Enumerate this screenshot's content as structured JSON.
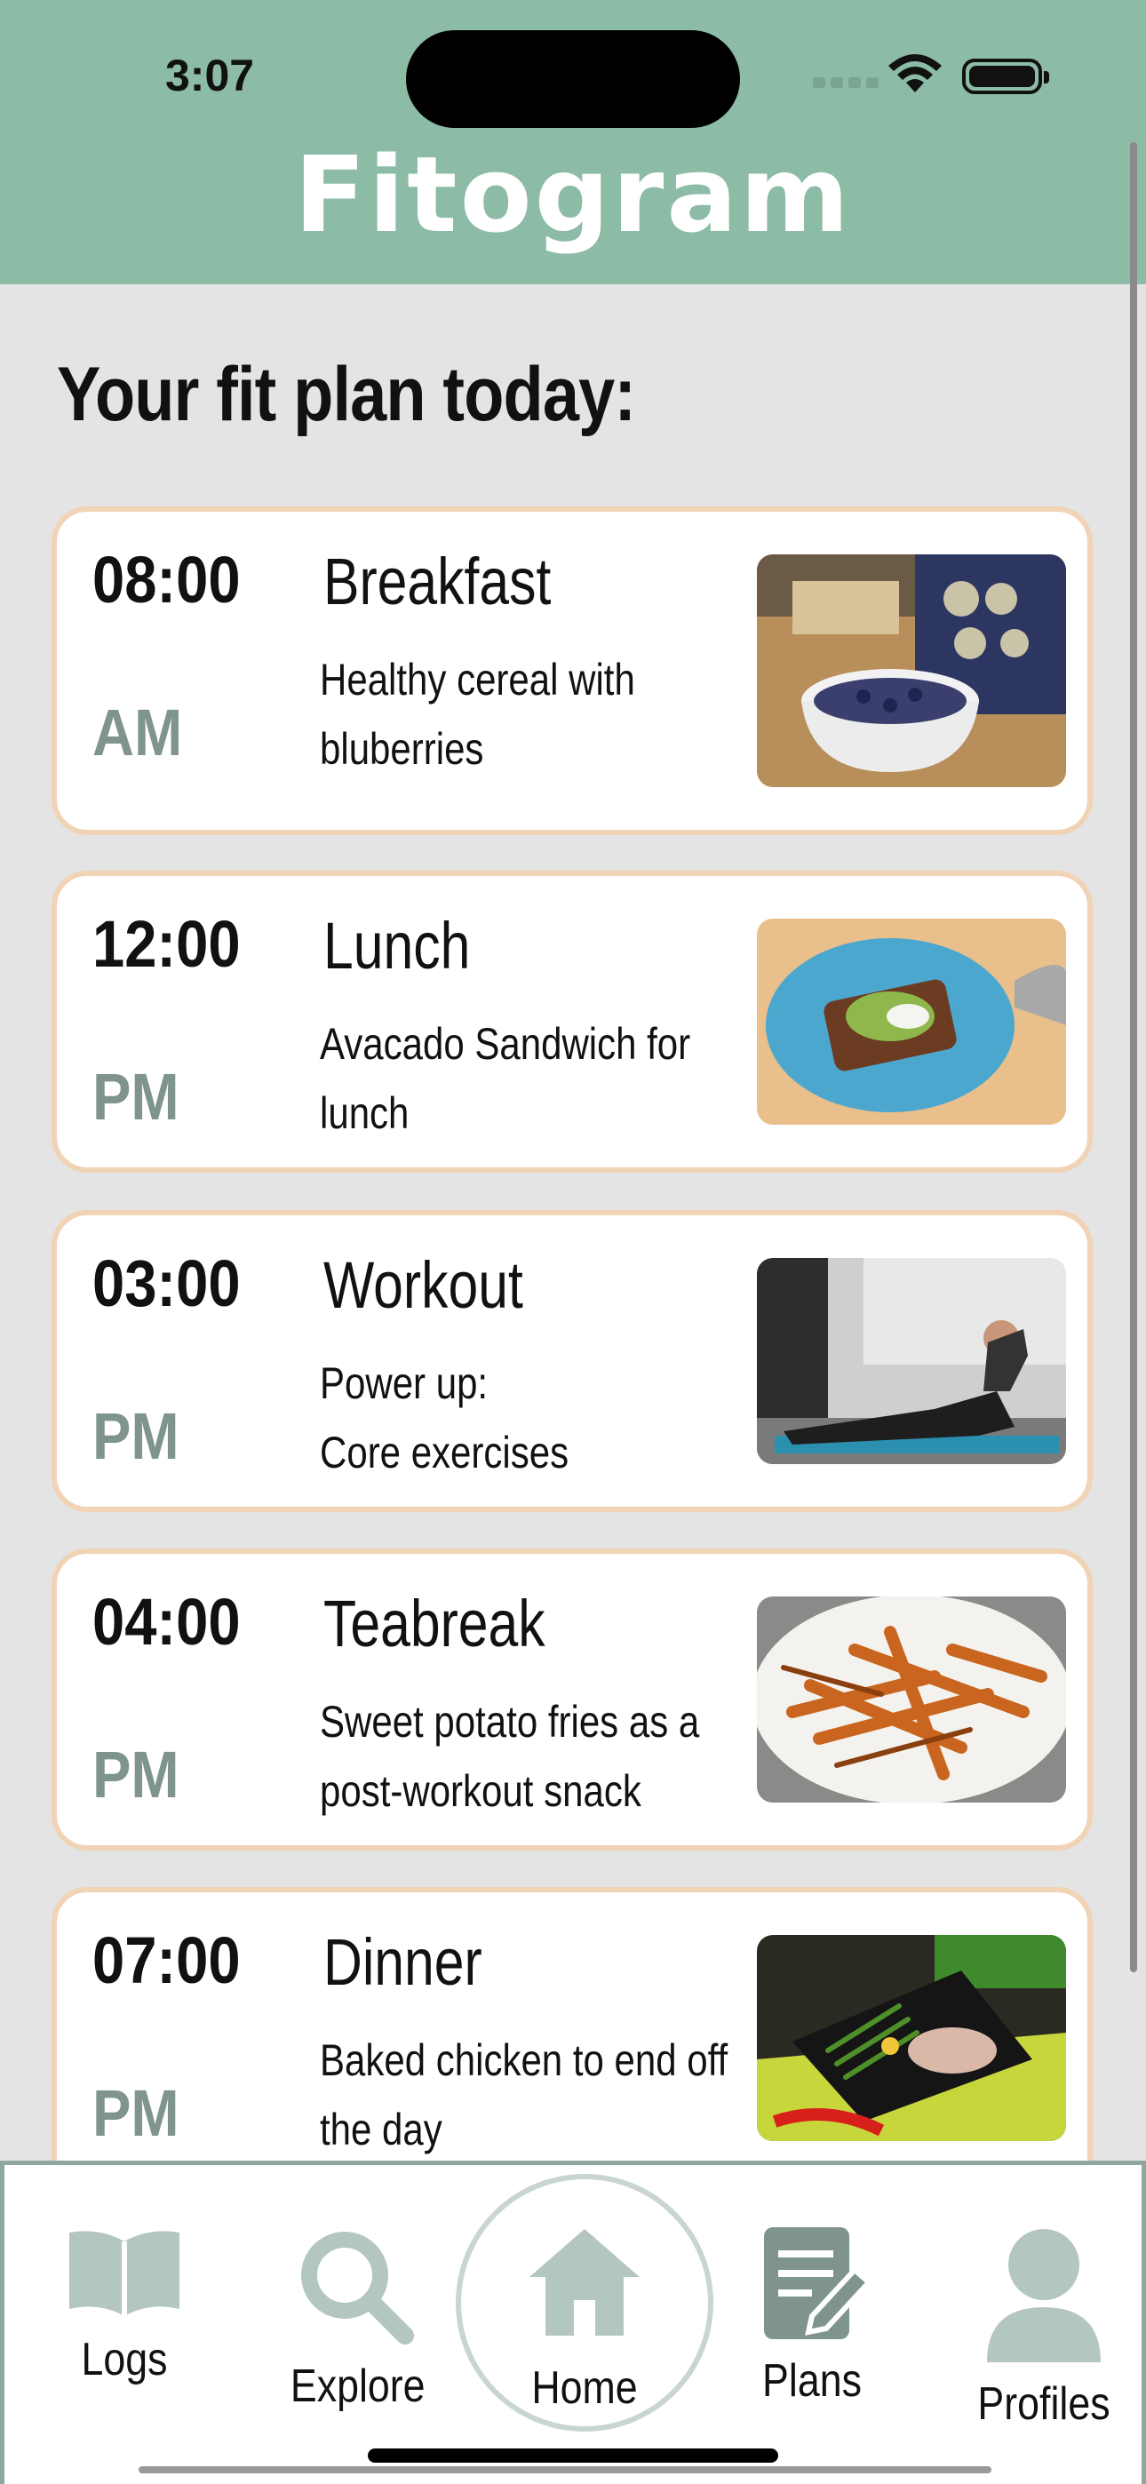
{
  "status_bar": {
    "time": "3:07"
  },
  "app": {
    "title": "Fitogram"
  },
  "main": {
    "heading": "Your fit plan today:",
    "items": [
      {
        "time": "08:00",
        "ampm": "AM",
        "title": "Breakfast",
        "description": "Healthy cereal with\nbluberries",
        "image": "cereal-bowl-photo"
      },
      {
        "time": "12:00",
        "ampm": "PM",
        "title": "Lunch",
        "description": "Avacado Sandwich for\nlunch",
        "image": "avocado-toast-photo"
      },
      {
        "time": "03:00",
        "ampm": "PM",
        "title": "Workout",
        "description": "Power up:\nCore exercises",
        "image": "plank-workout-photo"
      },
      {
        "time": "04:00",
        "ampm": "PM",
        "title": "Teabreak",
        "description": "Sweet potato fries as a\npost-workout snack",
        "image": "sweet-potato-fries-photo"
      },
      {
        "time": "07:00",
        "ampm": "PM",
        "title": "Dinner",
        "description": "Baked chicken to end off\nthe day",
        "image": "baked-chicken-photo"
      }
    ]
  },
  "tabbar": {
    "logs": "Logs",
    "explore": "Explore",
    "home": "Home",
    "plans": "Plans",
    "profiles": "Profiles"
  },
  "colors": {
    "header": "#8cbba6",
    "background": "#e4e4e4",
    "card_border": "#f1d3b5",
    "ampm": "#7f958c",
    "icon": "#b3c6bf"
  }
}
